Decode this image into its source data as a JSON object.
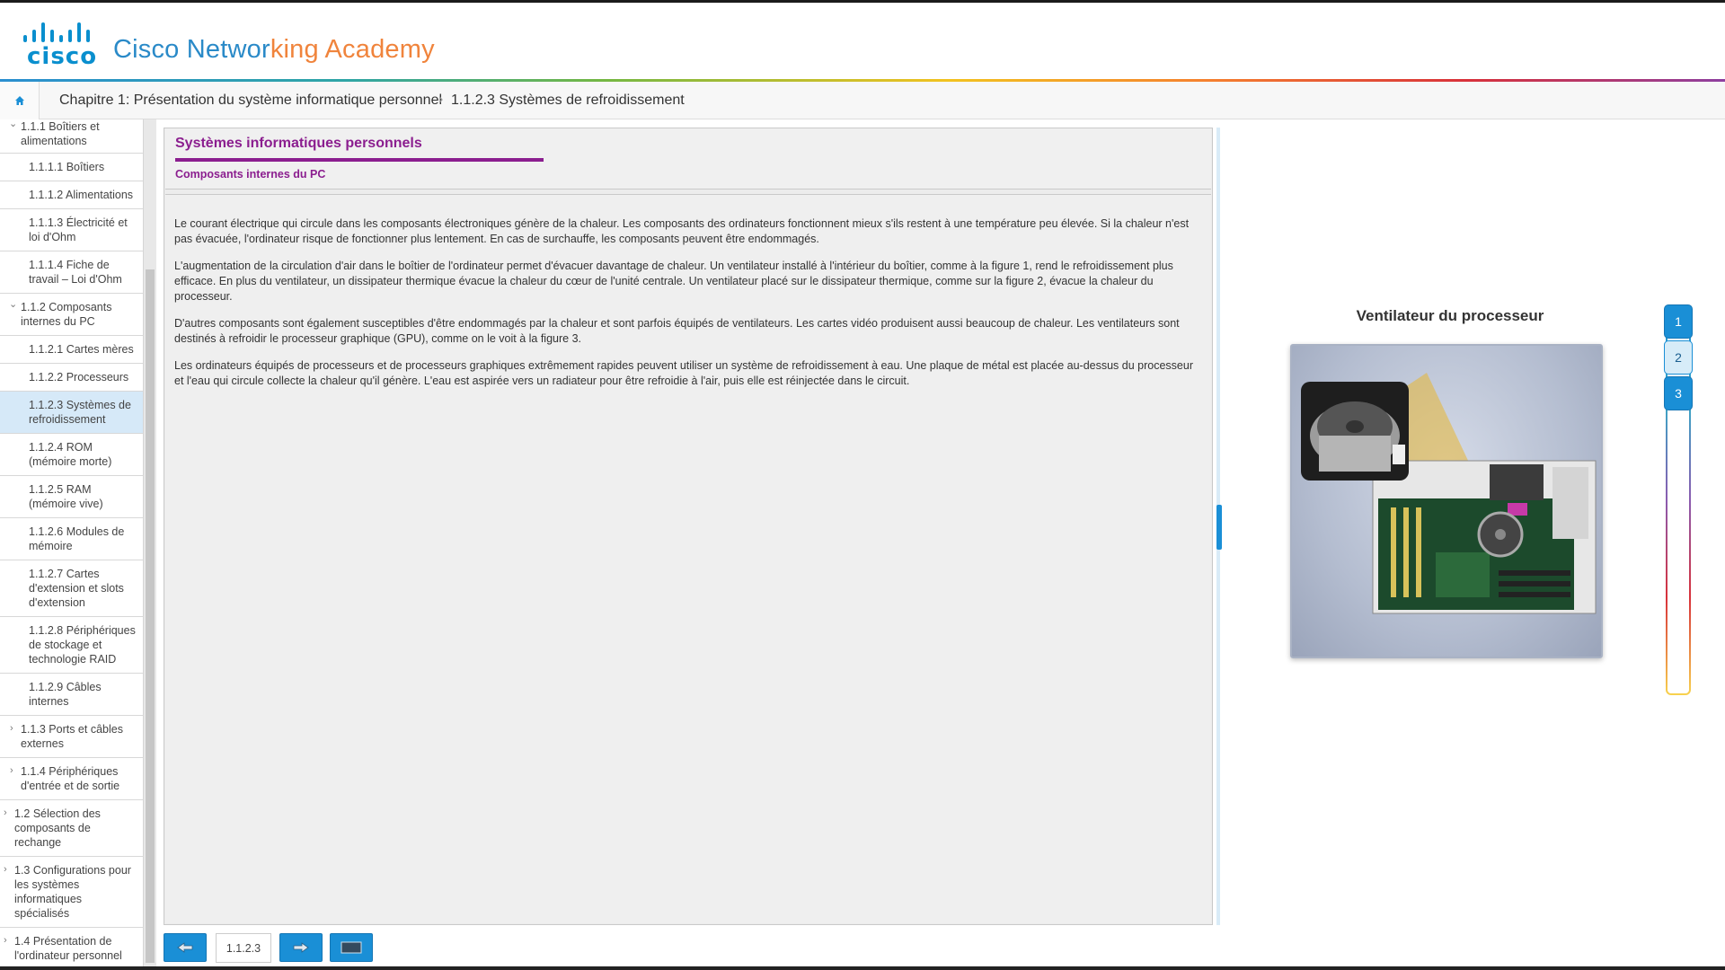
{
  "header": {
    "logo_word": "cisco",
    "brand_w1": "Cisco",
    "brand_w2": "Networ",
    "brand_w3": "king",
    "brand_w4": "Academy"
  },
  "breadcrumb": {
    "chapter": "Chapitre 1: Présentation du système informatique personnel",
    "separator": "›",
    "current": "1.1.2.3 Systèmes de refroidissement"
  },
  "sidebar": {
    "items": [
      {
        "label": "1.1.1 Boîtiers et alimentations",
        "chev": "⌄"
      },
      {
        "label": "1.1.1.1 Boîtiers"
      },
      {
        "label": "1.1.1.2 Alimentations"
      },
      {
        "label": "1.1.1.3 Électricité et loi d'Ohm"
      },
      {
        "label": "1.1.1.4 Fiche de travail – Loi d'Ohm"
      },
      {
        "label": "1.1.2 Composants internes du PC",
        "chev": "⌄"
      },
      {
        "label": "1.1.2.1 Cartes mères"
      },
      {
        "label": "1.1.2.2 Processeurs"
      },
      {
        "label": "1.1.2.3 Systèmes de refroidissement"
      },
      {
        "label": "1.1.2.4 ROM (mémoire morte)"
      },
      {
        "label": "1.1.2.5 RAM (mémoire vive)"
      },
      {
        "label": "1.1.2.6 Modules de mémoire"
      },
      {
        "label": "1.1.2.7 Cartes d'extension et slots d'extension"
      },
      {
        "label": "1.1.2.8 Périphériques de stockage et technologie RAID"
      },
      {
        "label": "1.1.2.9 Câbles internes"
      },
      {
        "label": "1.1.3 Ports et câbles externes",
        "chev": "›"
      },
      {
        "label": "1.1.4 Périphériques d'entrée et de sortie",
        "chev": "›"
      },
      {
        "label": "1.2 Sélection des composants de rechange",
        "chev": "›"
      },
      {
        "label": "1.3 Configurations pour les systèmes informatiques spécialisés",
        "chev": "›"
      },
      {
        "label": "1.4 Présentation de l'ordinateur personnel",
        "chev": "›"
      }
    ]
  },
  "content": {
    "title": "Systèmes informatiques personnels",
    "subtitle": "Composants internes du PC",
    "paragraphs": [
      "Le courant électrique qui circule dans les composants électroniques génère de la chaleur. Les composants des ordinateurs fonctionnent mieux s'ils restent à une température peu élevée. Si la chaleur n'est pas évacuée, l'ordinateur risque de fonctionner plus lentement. En cas de surchauffe, les composants peuvent être endommagés.",
      "L'augmentation de la circulation d'air dans le boîtier de l'ordinateur permet d'évacuer davantage de chaleur. Un ventilateur installé à l'intérieur du boîtier, comme à la figure 1, rend le refroidissement plus efficace. En plus du ventilateur, un dissipateur thermique évacue la chaleur du cœur de l'unité centrale. Un ventilateur placé sur le dissipateur thermique, comme sur la figure 2, évacue la chaleur du processeur.",
      "D'autres composants sont également susceptibles d'être endommagés par la chaleur et sont parfois équipés de ventilateurs. Les cartes vidéo produisent aussi beaucoup de chaleur. Les ventilateurs sont destinés à refroidir le processeur graphique (GPU), comme on le voit à la figure 3.",
      "Les ordinateurs équipés de processeurs et de processeurs graphiques extrêmement rapides peuvent utiliser un système de refroidissement à eau. Une plaque de métal est placée au-dessus du processeur et l'eau qui circule collecte la chaleur qu'il génère. L'eau est aspirée vers un radiateur pour être refroidie à l'air, puis elle est réinjectée dans le circuit."
    ]
  },
  "pager": {
    "page_number": "1.1.2.3"
  },
  "figure": {
    "title": "Ventilateur du processeur",
    "tabs": [
      "1",
      "2",
      "3"
    ],
    "selected_tab": "2"
  },
  "colors": {
    "accent": "#1a8fd6",
    "heading": "#8b1e8f"
  }
}
